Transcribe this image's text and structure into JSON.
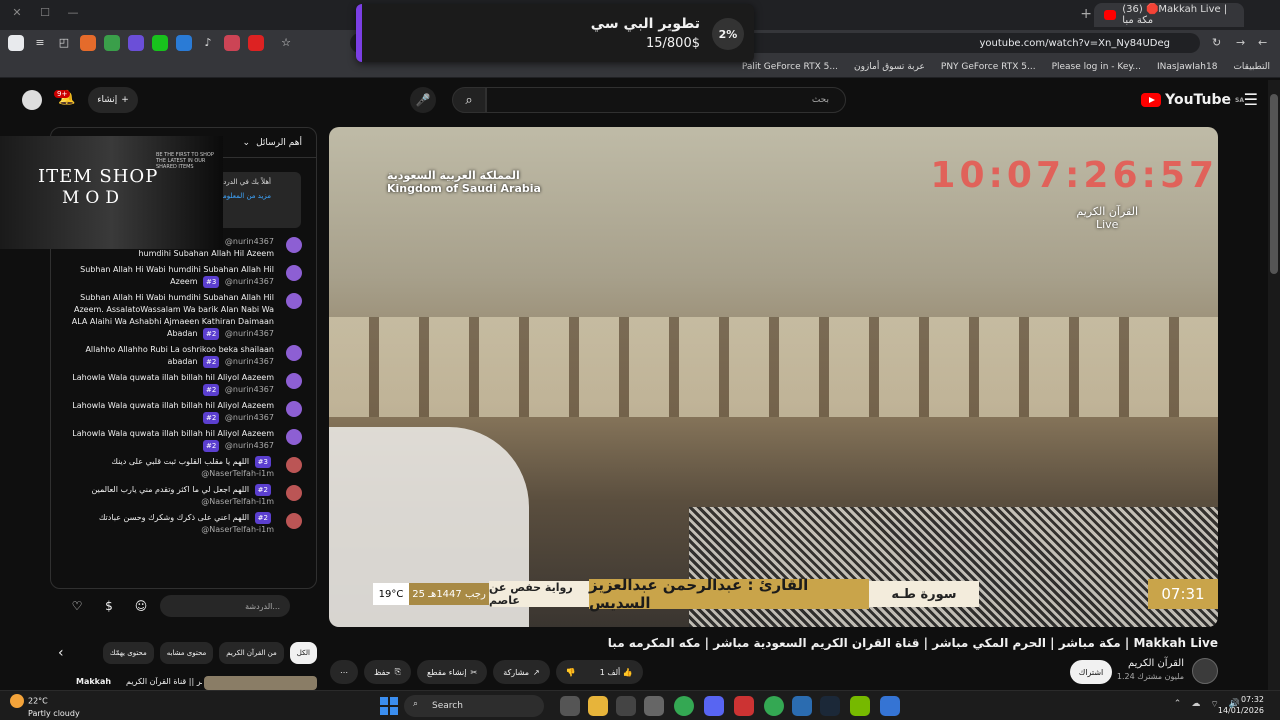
{
  "browser": {
    "tab_title": "(36) 🛑Makkah Live | مكة مبا",
    "url": "youtube.com/watch?v=Xn_Ny84UDeg",
    "bookmarks": [
      "التطبيقات",
      "INasJawIah18",
      "Please log in - Key...",
      "PNY GeForce RTX 5...",
      "عربة تسوق أمازون",
      "Palit GeForce RTX 5..."
    ]
  },
  "popup": {
    "title": "تطوير البي سي",
    "count": "15/800$",
    "percent": "2%"
  },
  "masthead": {
    "logo": "YouTube",
    "logo_region": "SA",
    "search_placeholder": "بحث",
    "create_label": "إنشاء",
    "notif_count": "9+"
  },
  "player": {
    "ksa_ar": "المملكة العربية السعودية",
    "ksa_en": "Kingdom of Saudi Arabia",
    "clock": "10:07:26:57",
    "quran_label": "القرآن الكريم",
    "live_label": "Live",
    "temp": "19°C",
    "date": "25 رجب 1447هـ",
    "riwaya": "رواية حفص عن عاصم",
    "reader": "القارئ : عبدالرحمن عبدالعزيز السديس",
    "surah": "سورة طـه",
    "time": "07:31"
  },
  "video": {
    "title": "مكة مباشر | الحرم المكي مباشر | قناة القران الكريم السعودية مباشر | مكه المكرمه مبا | Makkah Live",
    "channel_name": "القرآن الكريم",
    "channel_subs": "1.24 مليون مشترك",
    "subscribe": "اشتراك",
    "likes": "1 ألف",
    "share": "مشاركة",
    "clip": "إنشاء مقطع",
    "save": "حفظ"
  },
  "chat": {
    "header": "أهم الرسائل",
    "pinned": "أهلاً بك في الدردشة المباشرة! يُرجى الالتزام بإرشادات المنتدى",
    "pinned_more": "مزيد من المعلومات",
    "messages": [
      {
        "author": "@nurin4367",
        "badge": "",
        "text": "humdihi Subahan Allah Hil Azeem"
      },
      {
        "author": "@nurin4367",
        "badge": "#3",
        "text": "Subhan Allah Hi Wabi humdihi Subahan Allah Hil Azeem"
      },
      {
        "author": "@nurin4367",
        "badge": "#2",
        "text": "Subhan Allah Hi Wabi humdihi Subahan Allah Hil Azeem. AssalatoWassalam Wa barik Alan Nabi Wa ALA Alaihi Wa Ashabhi Ajmaeen Kathiran Daimaan Abadan"
      },
      {
        "author": "@nurin4367",
        "badge": "#2",
        "text": "Allahho Allahho Rubi La oshrikoo beka shailaan abadan"
      },
      {
        "author": "@nurin4367",
        "badge": "#2",
        "text": "Lahowla Wala quwata illah billah hil Aliyol Aazeem"
      },
      {
        "author": "@nurin4367",
        "badge": "#2",
        "text": "Lahowla Wala quwata illah billah hil Aliyol Aazeem"
      },
      {
        "author": "@nurin4367",
        "badge": "#2",
        "text": "Lahowla Wala quwata illah billah hil Aliyol Aazeem"
      },
      {
        "author": "@NaserTelfah-i1m",
        "badge": "#3",
        "text": "اللهم يا مقلب القلوب ثبت قلبي على دينك"
      },
      {
        "author": "@NaserTelfah-i1m",
        "badge": "#2",
        "text": "اللهم اجعل لي ما اكثر وتقدم مني يارب العالمين"
      },
      {
        "author": "@NaserTelfah-i1m",
        "badge": "#2",
        "text": "اللهم اعني على ذكرك وشكرك وحسن عبادتك"
      }
    ],
    "input_placeholder": "الدردشة..."
  },
  "itemshop": {
    "line1": "ITEM SHOP",
    "line2": "MOD",
    "tagline": "BE THE FIRST TO SHOP THE LATEST IN OUR SHARED ITEMS"
  },
  "chips": [
    "الكل",
    "من القرآن الكريم",
    "محتوى مشابه",
    "محتوى يهمّك"
  ],
  "recommendation": {
    "title": "بث مباشر || قناة القرآن الكريم",
    "channel": "Makkah"
  },
  "taskbar": {
    "temp": "22°C",
    "condition": "Partly cloudy",
    "search": "Search",
    "time": "07:32",
    "date": "14/01/2026"
  }
}
